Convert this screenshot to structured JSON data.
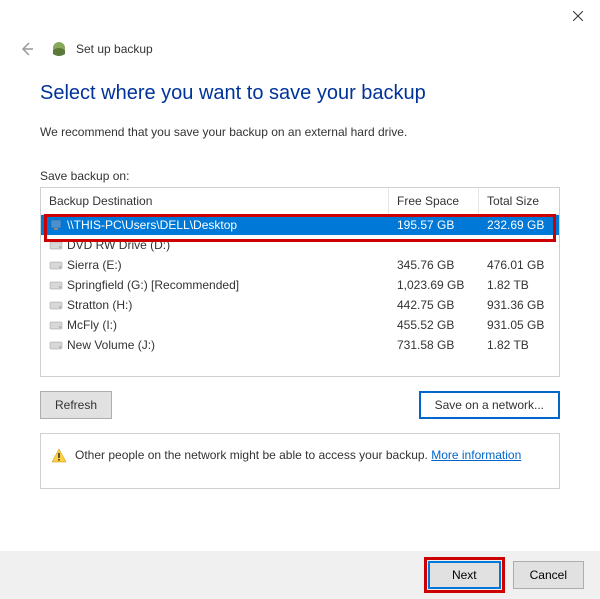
{
  "window": {
    "title": "Set up backup"
  },
  "heading": "Select where you want to save your backup",
  "recommend": "We recommend that you save your backup on an external hard drive.",
  "save_label": "Save backup on:",
  "table": {
    "headers": {
      "destination": "Backup Destination",
      "free": "Free Space",
      "total": "Total Size"
    },
    "rows": [
      {
        "name": "\\\\THIS-PC\\Users\\DELL\\Desktop",
        "free": "195.57 GB",
        "total": "232.69 GB",
        "selected": true
      },
      {
        "name": "DVD RW Drive (D:)",
        "free": "",
        "total": ""
      },
      {
        "name": "Sierra (E:)",
        "free": "345.76 GB",
        "total": "476.01 GB"
      },
      {
        "name": "Springfield (G:) [Recommended]",
        "free": "1,023.69 GB",
        "total": "1.82 TB"
      },
      {
        "name": "Stratton (H:)",
        "free": "442.75 GB",
        "total": "931.36 GB"
      },
      {
        "name": "McFly (I:)",
        "free": "455.52 GB",
        "total": "931.05 GB"
      },
      {
        "name": "New Volume (J:)",
        "free": "731.58 GB",
        "total": "1.82 TB"
      }
    ]
  },
  "buttons": {
    "refresh": "Refresh",
    "save_network": "Save on a network...",
    "next": "Next",
    "cancel": "Cancel"
  },
  "warning": {
    "text": "Other people on the network might be able to access your backup. ",
    "link": "More information"
  }
}
